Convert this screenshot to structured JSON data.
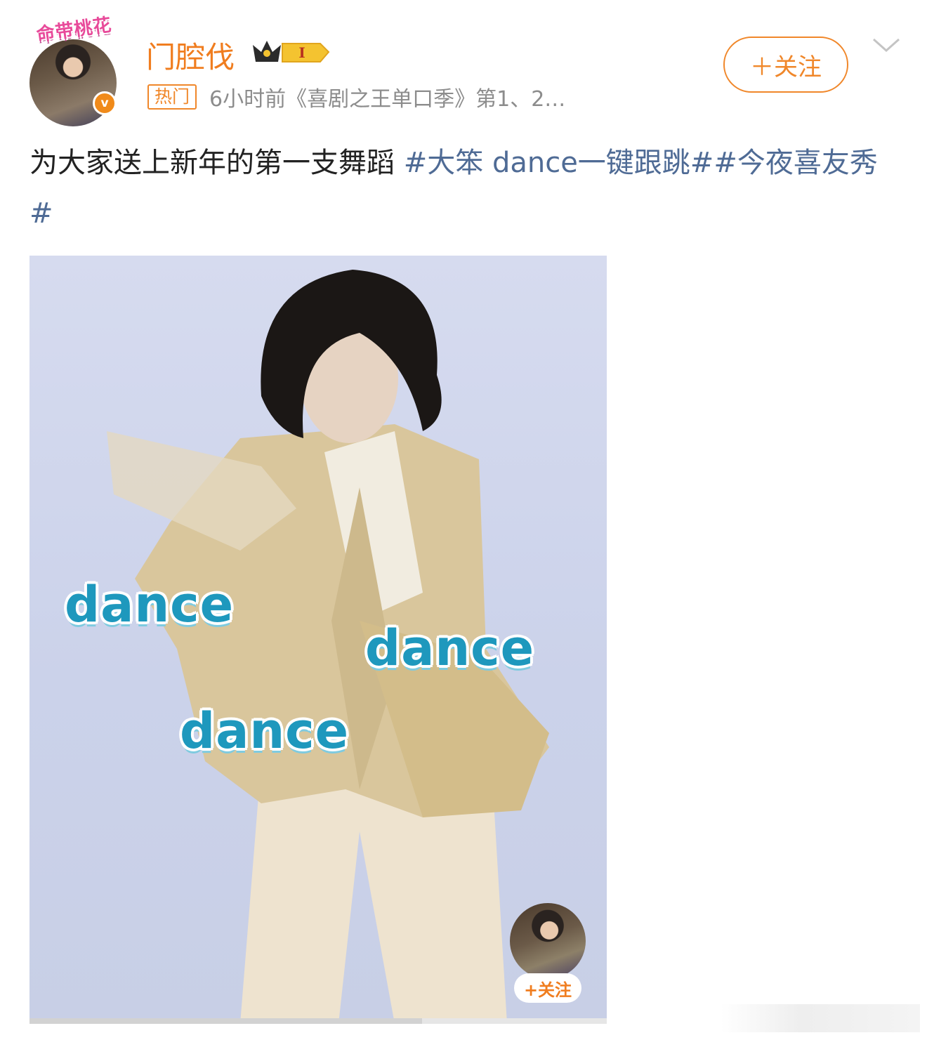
{
  "header": {
    "avatar_frame_text": "命带桃花",
    "verified_mark": "v",
    "username": "门腔伐",
    "level_badge": "I",
    "hot_tag": "热门",
    "meta_line": "6小时前《喜剧之王单口季》第1、2…",
    "follow_label": "＋关注",
    "menu_icon": "chevron-down-icon"
  },
  "post": {
    "text_plain": "为大家送上新年的第一支舞蹈 ",
    "hashtag_1": "#大笨 dance一键跟跳#",
    "hashtag_2": "#今夜喜友秀#"
  },
  "media": {
    "overlay_words": [
      "dance",
      "dance",
      "dance"
    ],
    "float_follow_label": "+关注",
    "progress": 0.68
  },
  "colors": {
    "accent": "#f07d1f",
    "hashtag": "#4f6b95",
    "overlay_text": "#1e98bd",
    "meta": "#8c8c8c"
  }
}
